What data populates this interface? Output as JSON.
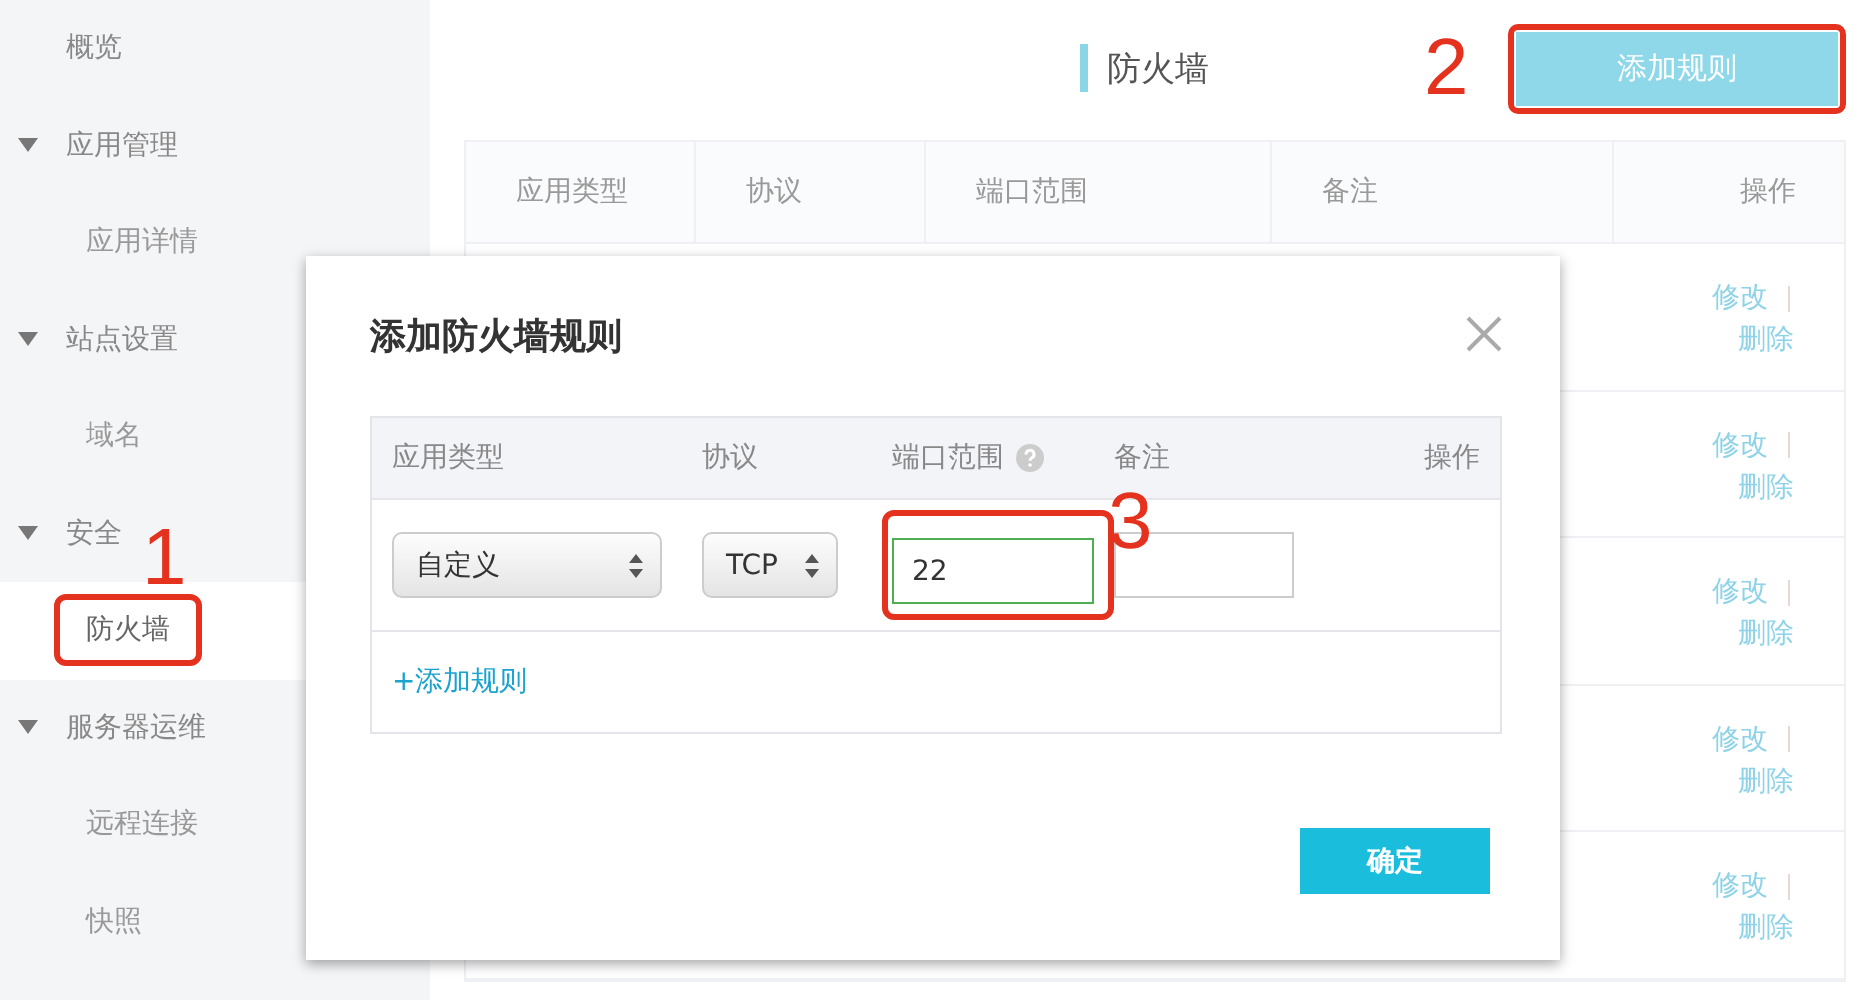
{
  "sidebar": {
    "items": [
      {
        "label": "概览",
        "selected": false
      },
      {
        "label": "应用管理",
        "expanded": true,
        "children": [
          {
            "label": "应用详情",
            "selected": false
          }
        ]
      },
      {
        "label": "站点设置",
        "expanded": true,
        "children": [
          {
            "label": "域名",
            "selected": false
          }
        ]
      },
      {
        "label": "安全",
        "expanded": true,
        "children": [
          {
            "label": "防火墙",
            "selected": true,
            "annotation": "1"
          }
        ]
      },
      {
        "label": "服务器运维",
        "expanded": true,
        "children": [
          {
            "label": "远程连接",
            "selected": false
          },
          {
            "label": "快照",
            "selected": false
          }
        ]
      }
    ]
  },
  "page": {
    "title": "防火墙",
    "add_button": {
      "label": "添加规则",
      "annotation": "2"
    }
  },
  "table": {
    "columns": [
      "应用类型",
      "协议",
      "端口范围",
      "备注",
      "操作"
    ],
    "rows": [
      {
        "actions": [
          "修改",
          "删除"
        ]
      },
      {
        "actions": [
          "修改",
          "删除"
        ]
      },
      {
        "actions": [
          "修改",
          "删除"
        ]
      },
      {
        "actions": [
          "修改",
          "删除"
        ]
      },
      {
        "actions": [
          "修改",
          "删除"
        ]
      }
    ]
  },
  "dialog": {
    "title": "添加防火墙规则",
    "columns": [
      {
        "label": "应用类型",
        "help": false
      },
      {
        "label": "协议",
        "help": false
      },
      {
        "label": "端口范围",
        "help": true
      },
      {
        "label": "备注",
        "help": false
      },
      {
        "label": "操作",
        "help": false
      }
    ],
    "rule": {
      "app_type": "自定义",
      "protocol": "TCP",
      "port": {
        "value": "22",
        "annotation": "3"
      }
    },
    "add_link": "+添加规则",
    "confirm": "确定"
  }
}
